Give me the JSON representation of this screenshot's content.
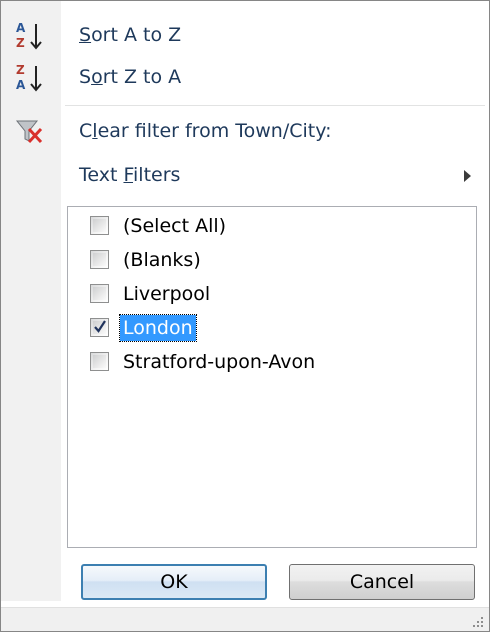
{
  "menu": {
    "sort_asc": {
      "pre": "",
      "key": "S",
      "post": "ort A to Z",
      "icon": "sort-ascending-icon"
    },
    "sort_desc": {
      "pre": "S",
      "key": "o",
      "post": "rt Z to A",
      "icon": "sort-descending-icon"
    },
    "clear_filter": {
      "pre": "C",
      "key": "l",
      "post": "ear filter from Town/City:",
      "icon": "clear-filter-icon"
    },
    "text_filters": {
      "pre": "Text ",
      "key": "F",
      "post": "ilters",
      "icon": "submenu-arrow-icon"
    }
  },
  "filter_list": {
    "items": [
      {
        "label": "(Select All)",
        "checked": false,
        "selected": false
      },
      {
        "label": "(Blanks)",
        "checked": false,
        "selected": false
      },
      {
        "label": "Liverpool",
        "checked": false,
        "selected": false
      },
      {
        "label": "London",
        "checked": true,
        "selected": true
      },
      {
        "label": "Stratford-upon-Avon",
        "checked": false,
        "selected": false
      }
    ]
  },
  "buttons": {
    "ok_label": "OK",
    "cancel_label": "Cancel"
  },
  "colors": {
    "menu_text": "#1e395b",
    "selection": "#3399ff",
    "ok_border": "#3c7fb1"
  }
}
